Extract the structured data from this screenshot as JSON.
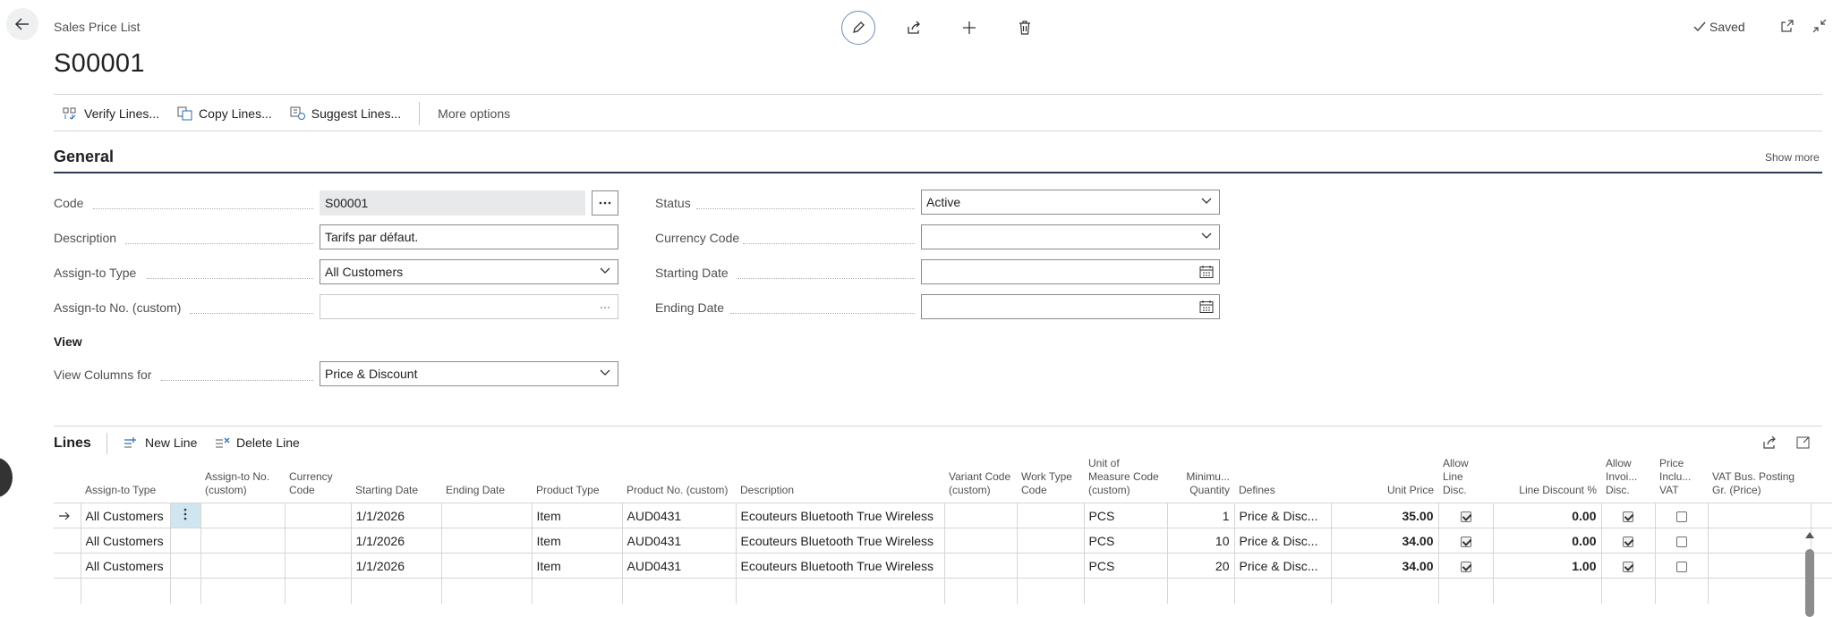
{
  "header": {
    "page_type": "Sales Price List",
    "title": "S00001",
    "saved_label": "Saved"
  },
  "actions": {
    "verify": "Verify Lines...",
    "copy": "Copy Lines...",
    "suggest": "Suggest Lines...",
    "more": "More options"
  },
  "general": {
    "title": "General",
    "show_more": "Show more",
    "code_label": "Code",
    "code_value": "S00001",
    "description_label": "Description",
    "description_value": "Tarifs par défaut.",
    "assign_type_label": "Assign-to Type",
    "assign_type_value": "All Customers",
    "assign_no_label": "Assign-to No. (custom)",
    "assign_no_value": "",
    "status_label": "Status",
    "status_value": "Active",
    "currency_label": "Currency Code",
    "currency_value": "",
    "starting_label": "Starting Date",
    "starting_value": "",
    "ending_label": "Ending Date",
    "ending_value": "",
    "view_heading": "View",
    "view_columns_label": "View Columns for",
    "view_columns_value": "Price & Discount"
  },
  "lines": {
    "title": "Lines",
    "new_line": "New Line",
    "delete_line": "Delete Line",
    "columns": [
      "Assign-to Type",
      "Assign-to No. (custom)",
      "Currency Code",
      "Starting Date",
      "Ending Date",
      "Product Type",
      "Product No. (custom)",
      "Description",
      "Variant Code (custom)",
      "Work Type Code",
      "Unit of Measure Code (custom)",
      "Minimu... Quantity",
      "Defines",
      "Unit Price",
      "Allow Line Disc.",
      "Line Discount %",
      "Allow Invoi... Disc.",
      "Price Inclu... VAT",
      "VAT Bus. Posting Gr. (Price)"
    ],
    "rows": [
      {
        "assign_type": "All Customers",
        "starting": "1/1/2026",
        "product_type": "Item",
        "product_no": "AUD0431",
        "description": "Ecouteurs Bluetooth True Wireless",
        "uom": "PCS",
        "min_qty": "1",
        "defines": "Price & Disc...",
        "unit_price": "35.00",
        "allow_line_disc": true,
        "line_disc": "0.00",
        "allow_inv_disc": true,
        "price_incl_vat": false
      },
      {
        "assign_type": "All Customers",
        "starting": "1/1/2026",
        "product_type": "Item",
        "product_no": "AUD0431",
        "description": "Ecouteurs Bluetooth True Wireless",
        "uom": "PCS",
        "min_qty": "10",
        "defines": "Price & Disc...",
        "unit_price": "34.00",
        "allow_line_disc": true,
        "line_disc": "0.00",
        "allow_inv_disc": true,
        "price_incl_vat": false
      },
      {
        "assign_type": "All Customers",
        "starting": "1/1/2026",
        "product_type": "Item",
        "product_no": "AUD0431",
        "description": "Ecouteurs Bluetooth True Wireless",
        "uom": "PCS",
        "min_qty": "20",
        "defines": "Price & Disc...",
        "unit_price": "34.00",
        "allow_line_disc": true,
        "line_disc": "1.00",
        "allow_inv_disc": true,
        "price_incl_vat": false
      }
    ]
  }
}
